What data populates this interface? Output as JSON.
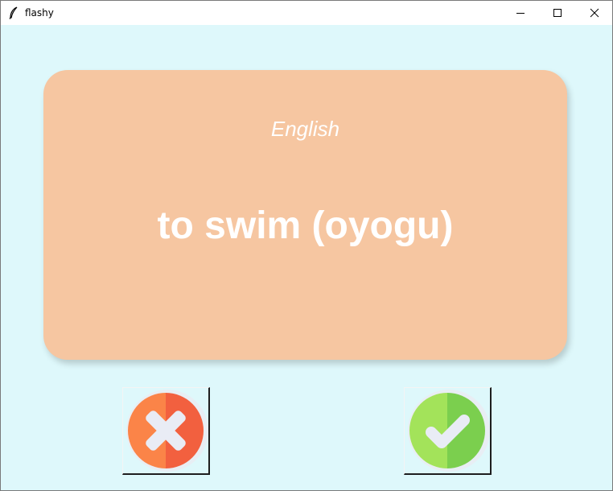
{
  "window": {
    "title": "flashy",
    "title_icon": "feather-icon",
    "controls": [
      "minimize-icon",
      "maximize-icon",
      "close-icon"
    ]
  },
  "colors": {
    "background": "#def8fb",
    "card": "#f6c6a1",
    "card_text": "#ffffff",
    "wrong_button": "#f4663f",
    "right_button": "#7fd14a"
  },
  "card": {
    "language": "English",
    "word": "to swim (oyogu)"
  },
  "buttons": {
    "wrong_icon": "cross-icon",
    "right_icon": "checkmark-icon"
  }
}
